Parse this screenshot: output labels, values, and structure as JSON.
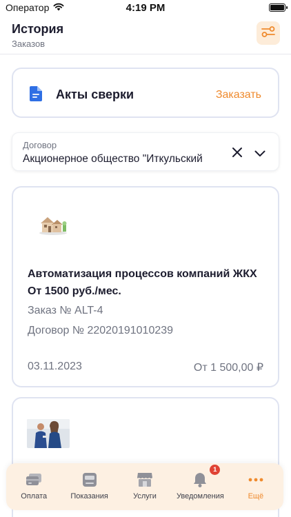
{
  "status_bar": {
    "carrier": "Оператор",
    "time": "4:19 PM"
  },
  "header": {
    "title": "История",
    "subtitle": "Заказов"
  },
  "acts_card": {
    "title": "Акты сверки",
    "order_label": "Заказать"
  },
  "contract_select": {
    "label": "Договор",
    "value": "Акционерное общество \"Иткульский"
  },
  "orders": [
    {
      "title": "Автоматизация процессов компаний ЖКХ От 1500 руб./мес.",
      "number": "Заказ № ALT-4",
      "contract": "Договор № 22020191010239",
      "date": "03.11.2023",
      "price": "От 1 500,00 ₽"
    }
  ],
  "tab_bar": {
    "tabs": [
      {
        "label": "Оплата",
        "icon": "payment-icon"
      },
      {
        "label": "Показания",
        "icon": "meter-icon"
      },
      {
        "label": "Услуги",
        "icon": "store-icon"
      },
      {
        "label": "Уведомления",
        "icon": "bell-icon",
        "badge": "1"
      },
      {
        "label": "Ещё",
        "icon": "more-dots-icon",
        "active": true
      }
    ]
  },
  "colors": {
    "accent": "#ef8a2d",
    "badge": "#e04335",
    "tab_bar_bg": "#fdf0e2",
    "card_border": "#dfe3f1"
  }
}
